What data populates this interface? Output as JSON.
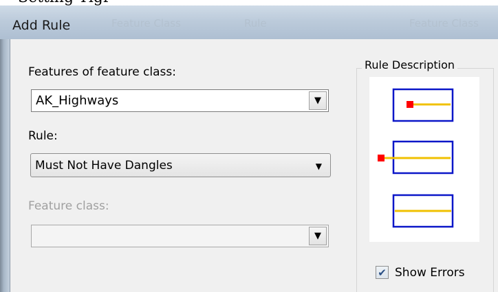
{
  "window": {
    "title": "Add Rule",
    "background_header_fragments": [
      "Feature Class",
      "Rule",
      "Feature Class"
    ]
  },
  "form": {
    "features_label": "Features of feature class:",
    "features_value": "AK_Highways",
    "rule_label": "Rule:",
    "rule_value": "Must Not Have Dangles",
    "feature_class_label": "Feature class:",
    "feature_class_value": ""
  },
  "rule_description": {
    "title": "Rule Description",
    "colors": {
      "box_border": "#0a16c8",
      "line": "#f0c000",
      "error_point": "#ff0000"
    },
    "examples": [
      "dangle-inside",
      "dangle-outside",
      "no-error"
    ]
  },
  "options": {
    "show_errors_label": "Show Errors",
    "show_errors_checked": true
  }
}
